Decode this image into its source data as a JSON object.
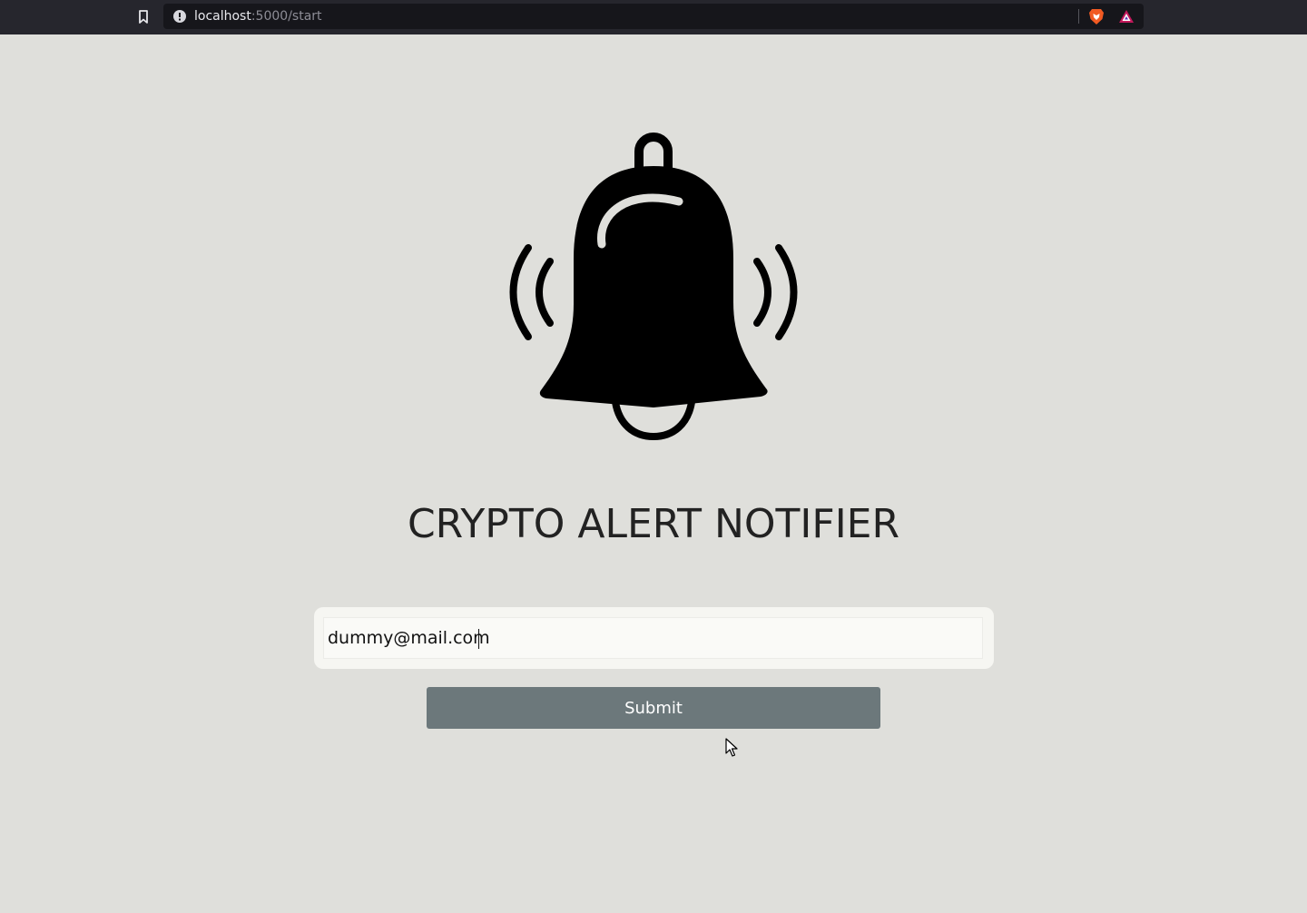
{
  "browser": {
    "url_host": "localhost",
    "url_path": ":5000/start",
    "icons": {
      "bookmark": "bookmark-icon",
      "site_info": "info-icon",
      "brave_shield": "brave-lion-icon",
      "rewards": "rewards-triangle-icon"
    }
  },
  "logo": {
    "icon": "ringing-bell-icon"
  },
  "page": {
    "title": "CRYPTO ALERT NOTIFIER"
  },
  "form": {
    "email_value": "dummy@mail.com",
    "submit_label": "Submit"
  },
  "colors": {
    "background": "#dfdfdb",
    "browser_bar": "#26262d",
    "button": "#6c787b",
    "title": "#222222"
  }
}
